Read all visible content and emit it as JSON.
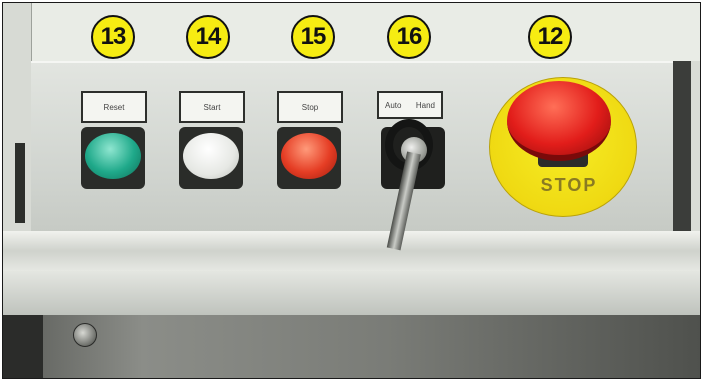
{
  "callouts": [
    "13",
    "14",
    "15",
    "16",
    "12"
  ],
  "button_labels": {
    "reset": "Reset",
    "start": "Start",
    "stop": "Stop",
    "auto": "Auto",
    "hand": "Hand"
  },
  "estop_text": "STOP",
  "colors": {
    "callout_fill": "#f6ec12",
    "reset_button": "#1fa98a",
    "start_button": "#e6e8e4",
    "stop_button": "#e53d24",
    "estop_head": "#e21d1a",
    "estop_ring": "#efd912"
  }
}
